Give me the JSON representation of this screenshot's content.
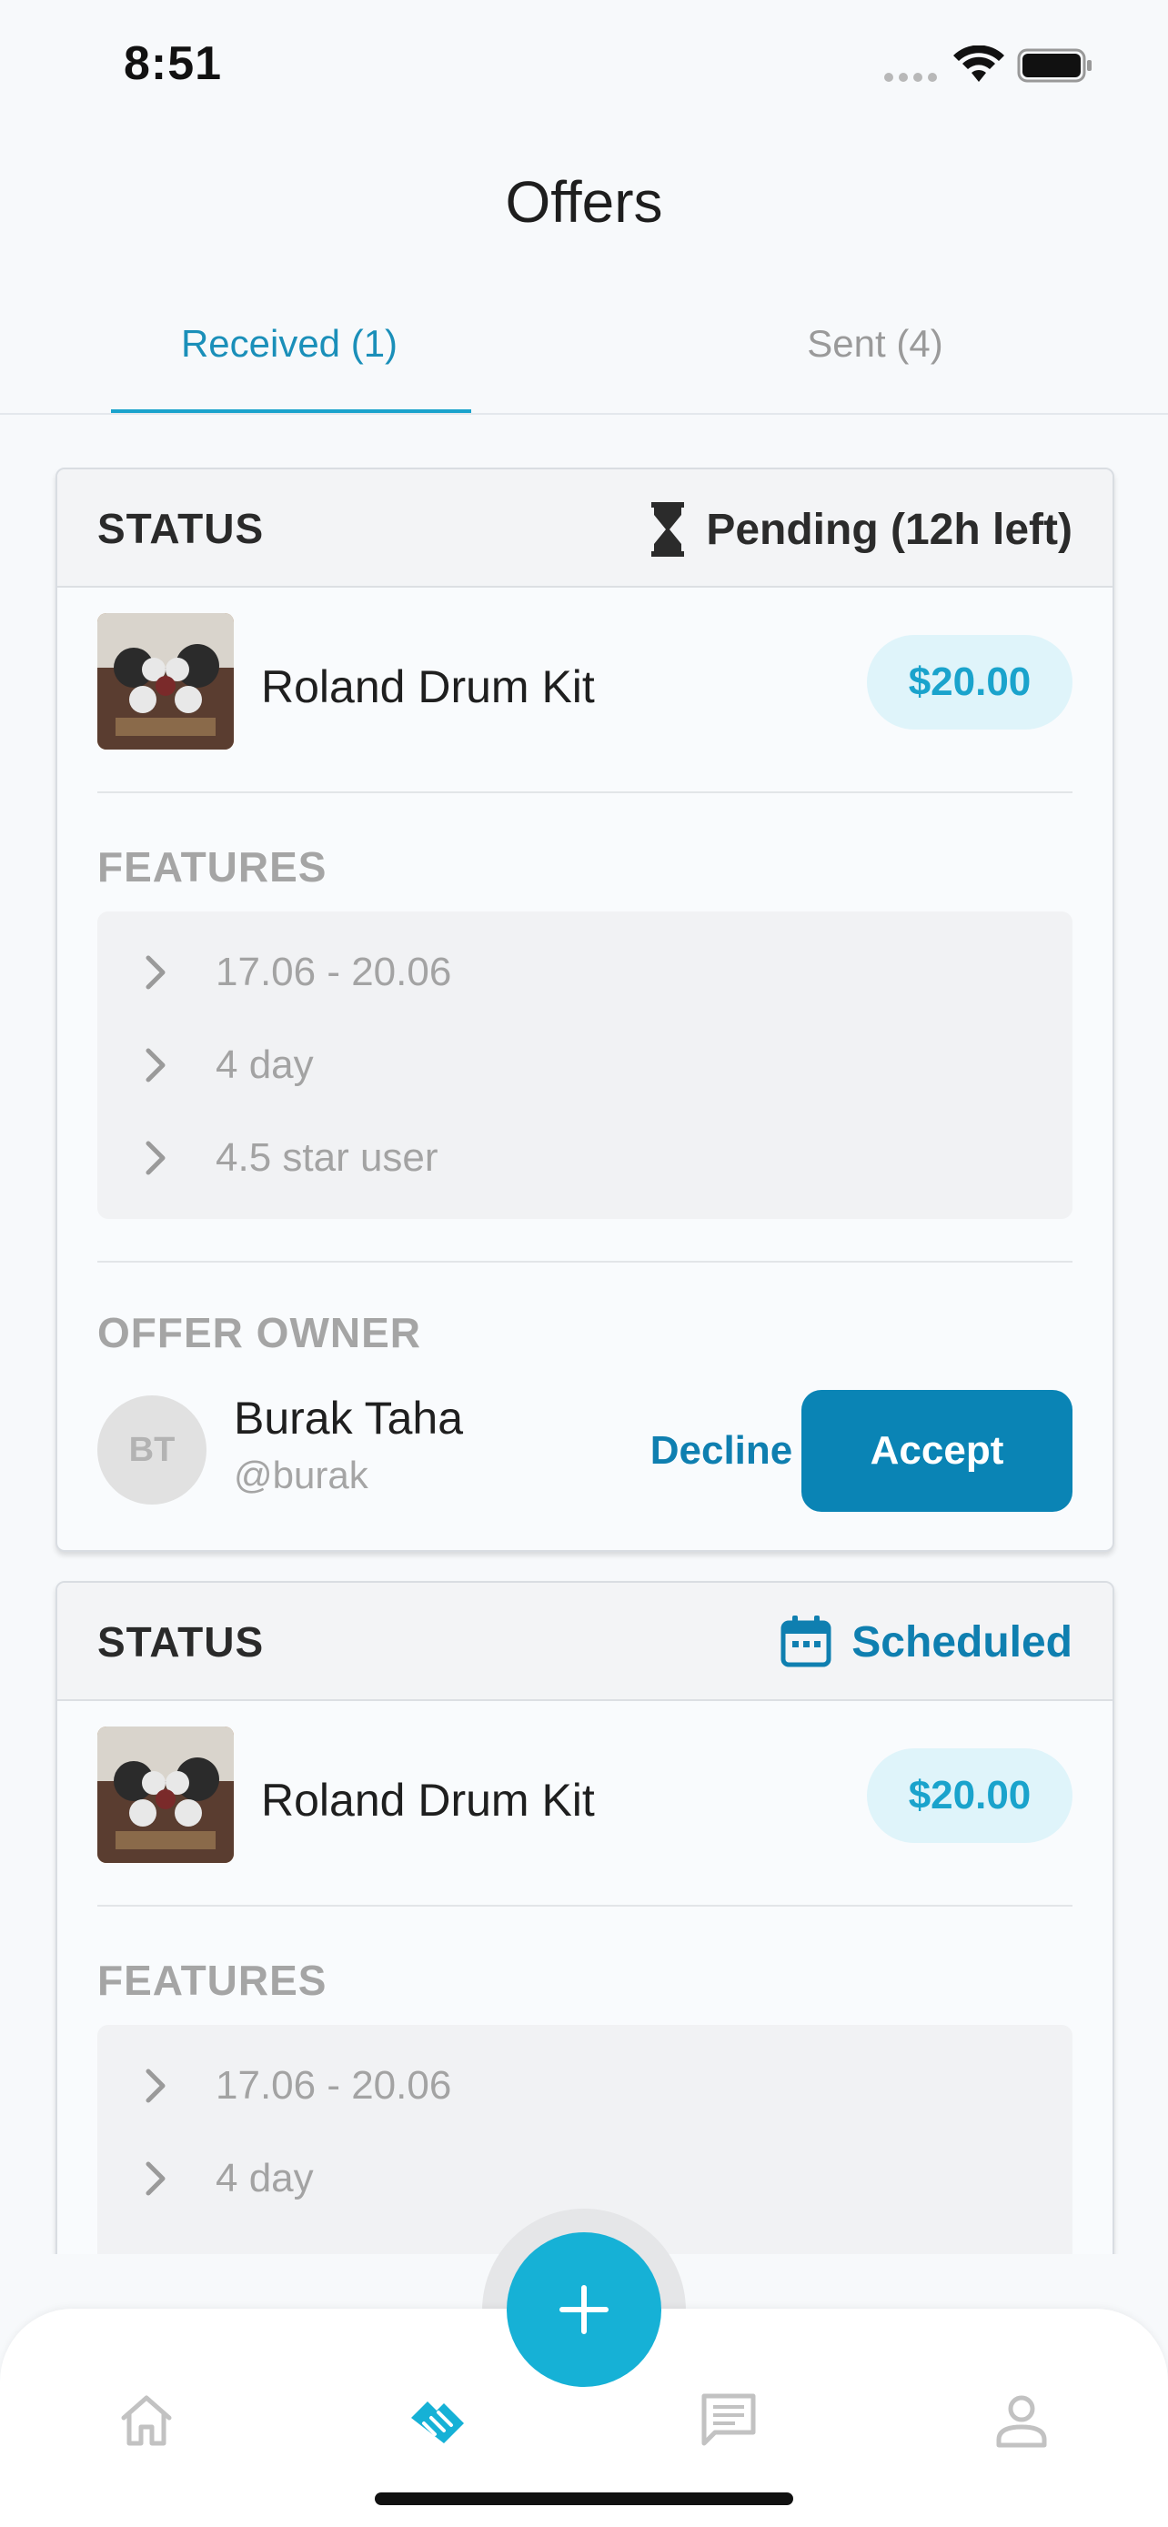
{
  "status_bar": {
    "time": "8:51"
  },
  "header": {
    "title": "Offers"
  },
  "tabs": [
    {
      "label": "Received (1)",
      "active": true
    },
    {
      "label": "Sent (4)",
      "active": false
    }
  ],
  "cards": [
    {
      "status_label": "STATUS",
      "status_value": "Pending (12h left)",
      "status_icon": "hourglass-icon",
      "item_name": "Roland Drum Kit",
      "price": "$20.00",
      "features_label": "FEATURES",
      "features": [
        "17.06 - 20.06",
        "4 day",
        "4.5 star user"
      ],
      "owner_label": "OFFER OWNER",
      "owner": {
        "initials": "BT",
        "name": "Burak Taha",
        "handle": "@burak"
      },
      "decline_label": "Decline",
      "accept_label": "Accept"
    },
    {
      "status_label": "STATUS",
      "status_value": "Scheduled",
      "status_icon": "calendar-icon",
      "item_name": "Roland Drum Kit",
      "price": "$20.00",
      "features_label": "FEATURES",
      "features": [
        "17.06 - 20.06",
        "4 day"
      ]
    }
  ],
  "bottom_nav": {
    "items": [
      "home-icon",
      "offers-icon",
      "chat-icon",
      "profile-icon"
    ],
    "active": "offers-icon",
    "fab_icon": "plus-icon"
  },
  "colors": {
    "accent": "#1aa3cc",
    "primary_button": "#0a84b5",
    "price_pill": "#dff4fa",
    "scheduled": "#0f7fb0"
  }
}
